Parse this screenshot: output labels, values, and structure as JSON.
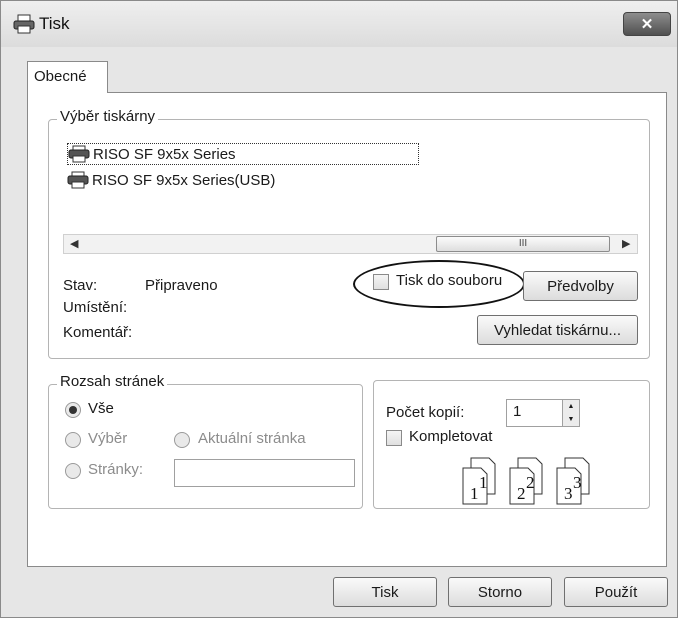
{
  "window": {
    "title": "Tisk",
    "close_label": "✕"
  },
  "tabs": [
    {
      "label": "Obecné",
      "active": true
    }
  ],
  "printer_group": {
    "legend": "Výběr tiskárny",
    "printers": [
      {
        "name": "RISO SF 9x5x Series",
        "selected": true
      },
      {
        "name": "RISO SF 9x5x Series(USB)",
        "selected": false
      }
    ],
    "scroll_thumb_label": "III",
    "status_label": "Stav:",
    "status_value": "Připraveno",
    "location_label": "Umístění:",
    "comment_label": "Komentář:",
    "print_to_file_label": "Tisk do souboru",
    "print_to_file_checked": false,
    "preferences_button": "Předvolby",
    "find_printer_button": "Vyhledat tiskárnu..."
  },
  "page_range": {
    "legend": "Rozsah stránek",
    "all_label": "Vše",
    "selection_label": "Výběr",
    "current_page_label": "Aktuální stránka",
    "pages_label": "Stránky:",
    "pages_value": "",
    "selected_option": "all"
  },
  "copies": {
    "count_label": "Počet kopií:",
    "count_value": "1",
    "collate_label": "Kompletovat",
    "collate_checked": false,
    "collate_pages": [
      "1",
      "1",
      "2",
      "2",
      "3",
      "3"
    ]
  },
  "buttons": {
    "print": "Tisk",
    "cancel": "Storno",
    "apply": "Použít"
  }
}
